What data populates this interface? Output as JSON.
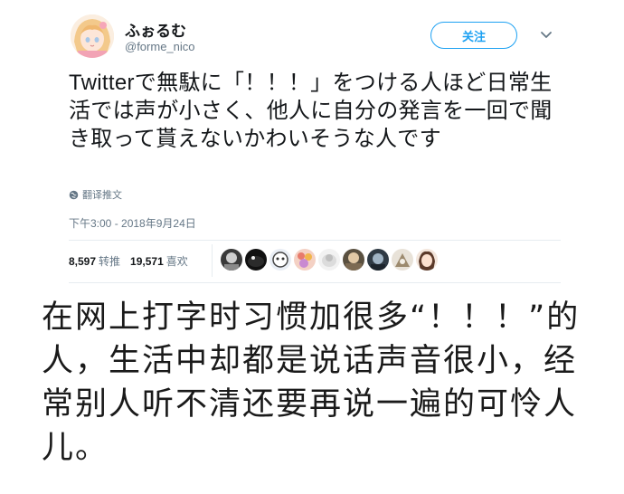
{
  "tweet": {
    "display_name": "ふぉるむ",
    "handle": "@forme_nico",
    "follow_label": "关注",
    "text": "Twitterで無駄に「！！！」をつける人ほど日常生活では声が小さく、他人に自分の発言を一回で聞き取って貰えないかわいそうな人です",
    "translate_label": "翻译推文",
    "timestamp": "下午3:00 - 2018年9月24日",
    "retweets_count": "8,597",
    "retweets_label": "转推",
    "likes_count": "19,571",
    "likes_label": "喜欢",
    "icons": {
      "menu": "chevron-down-icon",
      "translate": "globe-icon"
    },
    "accent_color": "#1da1f2"
  },
  "caption": {
    "text": "在网上打字时习惯加很多“！！！”的人，生活中却都是说话声音很小，经常别人听不清还要再说一遍的可怜人儿。"
  }
}
